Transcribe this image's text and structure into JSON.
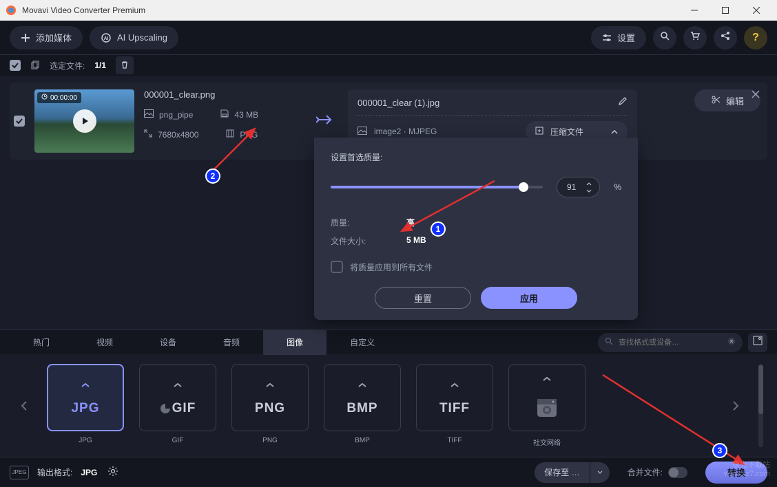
{
  "window": {
    "title": "Movavi Video Converter Premium"
  },
  "toolbar": {
    "add_media": "添加媒体",
    "ai_upscaling": "AI Upscaling",
    "settings": "设置"
  },
  "selection": {
    "label": "选定文件:",
    "count": "1/1"
  },
  "file": {
    "duration": "00:00:00",
    "name": "000001_clear.png",
    "codec": "png_pipe",
    "size": "43 MB",
    "resolution": "7680x4800",
    "format": "PNG"
  },
  "output": {
    "name": "000001_clear (1).jpg",
    "codec": "image2 · MJPEG",
    "compress_label": "压缩文件",
    "edit_label": "编辑"
  },
  "quality_panel": {
    "title": "设置首选质量:",
    "percent": "91",
    "unit": "%",
    "quality_label": "质量:",
    "quality_value": "高",
    "size_label": "文件大小:",
    "size_value": "5 MB",
    "apply_all": "将质量应用到所有文件",
    "reset": "重置",
    "apply": "应用"
  },
  "tabs": {
    "popular": "热门",
    "video": "视频",
    "devices": "设备",
    "audio": "音频",
    "image": "图像",
    "custom": "自定义"
  },
  "search": {
    "placeholder": "查找格式或设备…"
  },
  "formats": [
    {
      "label": "JPG",
      "caption": "JPG",
      "active": true
    },
    {
      "label": "GIF",
      "caption": "GIF"
    },
    {
      "label": "PNG",
      "caption": "PNG"
    },
    {
      "label": "BMP",
      "caption": "BMP"
    },
    {
      "label": "TIFF",
      "caption": "TIFF"
    },
    {
      "label": "",
      "caption": "社交网络",
      "icon": "camera"
    }
  ],
  "bottom": {
    "output_format_label": "输出格式:",
    "output_format_value": "JPG",
    "save_to": "保存至 …",
    "merge_label": "合并文件:",
    "convert": "转换"
  },
  "annotations": {
    "n1": "1",
    "n2": "2",
    "n3": "3"
  },
  "watermark": {
    "line1": "极光下载站",
    "line2": "www.xz7.com"
  }
}
